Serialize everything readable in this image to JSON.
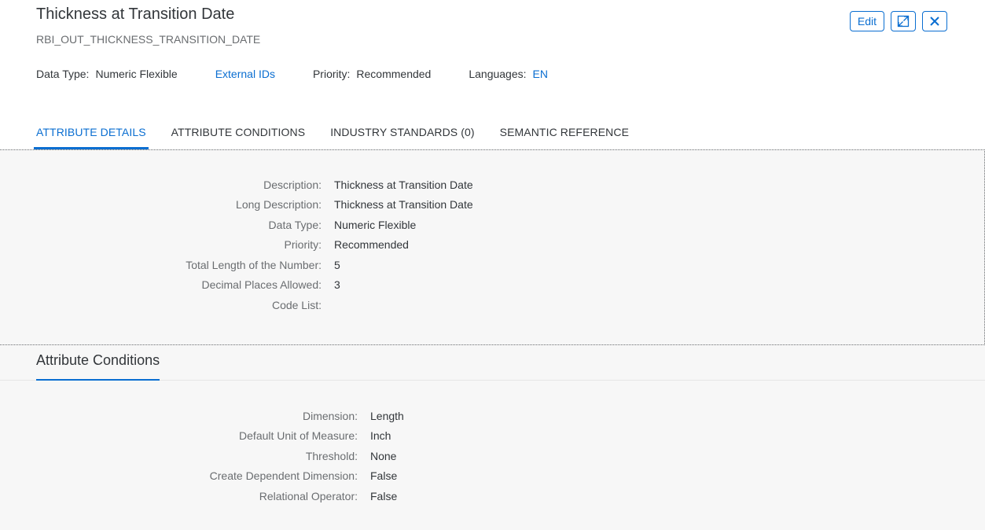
{
  "header": {
    "title": "Thickness at Transition Date",
    "subtitle": "RBI_OUT_THICKNESS_TRANSITION_DATE",
    "edit_label": "Edit",
    "attributes": {
      "data_type_label": "Data Type:",
      "data_type_value": "Numeric Flexible",
      "external_ids_label": "External IDs",
      "priority_label": "Priority:",
      "priority_value": "Recommended",
      "languages_label": "Languages:",
      "languages_value": "EN"
    }
  },
  "tabs": [
    {
      "label": "ATTRIBUTE DETAILS",
      "active": true
    },
    {
      "label": "ATTRIBUTE CONDITIONS",
      "active": false
    },
    {
      "label": "INDUSTRY STANDARDS (0)",
      "active": false
    },
    {
      "label": "SEMANTIC REFERENCE",
      "active": false
    }
  ],
  "details": {
    "rows": [
      {
        "label": "Description:",
        "value": "Thickness at Transition Date"
      },
      {
        "label": "Long Description:",
        "value": "Thickness at Transition Date"
      },
      {
        "label": "Data Type:",
        "value": "Numeric Flexible"
      },
      {
        "label": "Priority:",
        "value": "Recommended"
      },
      {
        "label": "Total Length of the Number:",
        "value": "5"
      },
      {
        "label": "Decimal Places Allowed:",
        "value": "3"
      },
      {
        "label": "Code List:",
        "value": ""
      }
    ]
  },
  "conditions": {
    "title": "Attribute Conditions",
    "rows": [
      {
        "label": "Dimension:",
        "value": "Length"
      },
      {
        "label": "Default Unit of Measure:",
        "value": "Inch"
      },
      {
        "label": "Threshold:",
        "value": "None"
      },
      {
        "label": "Create Dependent Dimension:",
        "value": "False"
      },
      {
        "label": "Relational Operator:",
        "value": "False"
      }
    ]
  },
  "icons": {
    "expand": "expand-icon",
    "close": "close-icon"
  },
  "colors": {
    "accent": "#0a6ed1",
    "text": "#32363a",
    "muted": "#6a6d70",
    "section_bg": "#f7f7f7"
  }
}
